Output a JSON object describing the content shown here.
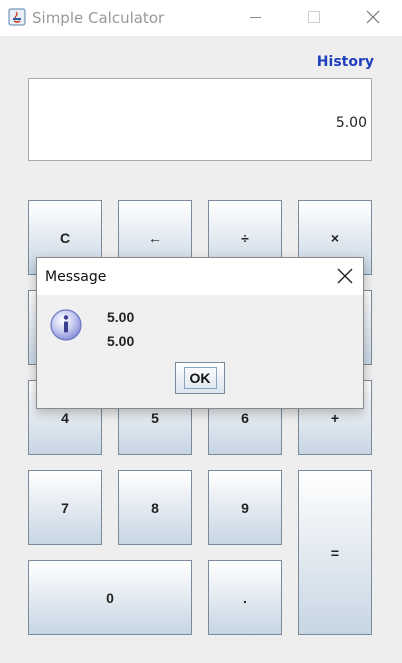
{
  "window": {
    "title": "Simple Calculator"
  },
  "history_label": "History",
  "display": {
    "value": "5.00"
  },
  "keys": {
    "clear": "C",
    "backspace": "←",
    "divide": "÷",
    "multiply": "×",
    "seven": "7",
    "eight": "8",
    "nine": "9",
    "four": "4",
    "five": "5",
    "six": "6",
    "plus": "+",
    "equals": "=",
    "zero": "0",
    "decimal": "."
  },
  "dialog": {
    "title": "Message",
    "lines": [
      "5.00",
      "5.00"
    ],
    "ok_label": "OK"
  }
}
